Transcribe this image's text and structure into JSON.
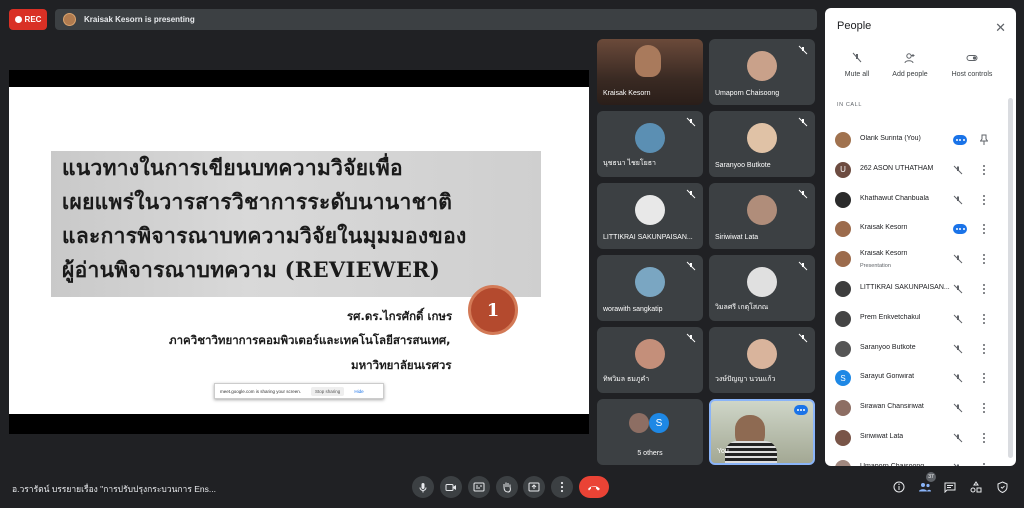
{
  "top": {
    "rec_label": "REC",
    "presenting_text": "Kraisak Kesorn is presenting"
  },
  "slide": {
    "headline": [
      "แนวทางในการเขียนบทความวิจัยเพื่อ",
      "เผยแพร่ในวารสารวิชาการระดับนานาชาติ",
      "และการพิจารณาบทความวิจัยในมุมมองของ",
      "ผู้อ่านพิจารณาบทความ (REVIEWER)"
    ],
    "badge": "1",
    "author_name": "รศ.ดร.ไกรศักดิ์ เกษร",
    "author_dept": "ภาควิชาวิทยาการคอมพิวเตอร์และเทคโนโลยีสารสนเทศ,",
    "author_univ": "มหาวิทยาลัยนเรศวร"
  },
  "share_bar": {
    "text": "meet.google.com is sharing your screen.",
    "stop_label": "Stop sharing",
    "hide_label": "Hide"
  },
  "tiles": [
    {
      "name": "Kraisak Kesorn"
    },
    {
      "name": "Umaporn Chaisoong"
    },
    {
      "name": "นุชธนา ไชยโยธา"
    },
    {
      "name": "Saranyoo Butkote"
    },
    {
      "name": "LITTIKRAI SAKUNPAISAN..."
    },
    {
      "name": "Siriwiwat Lata"
    },
    {
      "name": "worawith sangkatip"
    },
    {
      "name": "วิมลศรี เกตุโสภณ"
    },
    {
      "name": "ทิพวิมล ธมภูคำ"
    },
    {
      "name": "วงษ์ปัญญา นวนแก้ว"
    },
    {
      "name": "5 others",
      "s_letter": "S"
    },
    {
      "name": "You"
    }
  ],
  "panel": {
    "title": "People",
    "actions": [
      "Mute all",
      "Add people",
      "Host controls"
    ],
    "section": "IN CALL",
    "people": [
      {
        "name": "Olarik Surinta (You)",
        "color": "#a0724f",
        "letter": ""
      },
      {
        "name": "262 ASON UTHATHAM",
        "color": "#6d4c41",
        "letter": "U"
      },
      {
        "name": "Khathawut Chanbuala",
        "color": "#2b2b2b",
        "letter": ""
      },
      {
        "name": "Kraisak Kesorn",
        "color": "#9c6b4c",
        "letter": ""
      },
      {
        "name": "Kraisak Kesorn",
        "sub": "Presentation",
        "color": "#9c6b4c",
        "letter": ""
      },
      {
        "name": "LITTIKRAI SAKUNPAISAN...",
        "color": "#3d3d3d",
        "letter": ""
      },
      {
        "name": "Prem Enkvetchakul",
        "color": "#444",
        "letter": ""
      },
      {
        "name": "Saranyoo Butkote",
        "color": "#555",
        "letter": ""
      },
      {
        "name": "Sarayut Gonwirat",
        "color": "#1e88e5",
        "letter": "S"
      },
      {
        "name": "Sirawan Chansiriwat",
        "color": "#8d6e63",
        "letter": ""
      },
      {
        "name": "Siriwiwat Lata",
        "color": "#795548",
        "letter": ""
      },
      {
        "name": "Umaporn Chaisoong",
        "color": "#a1887f",
        "letter": ""
      }
    ]
  },
  "bottom": {
    "meeting_title": "อ.วรารัตน์ บรรยายเรื่อง \"การปรับปรุงกระบวนการ Ens...",
    "people_count": "37"
  }
}
